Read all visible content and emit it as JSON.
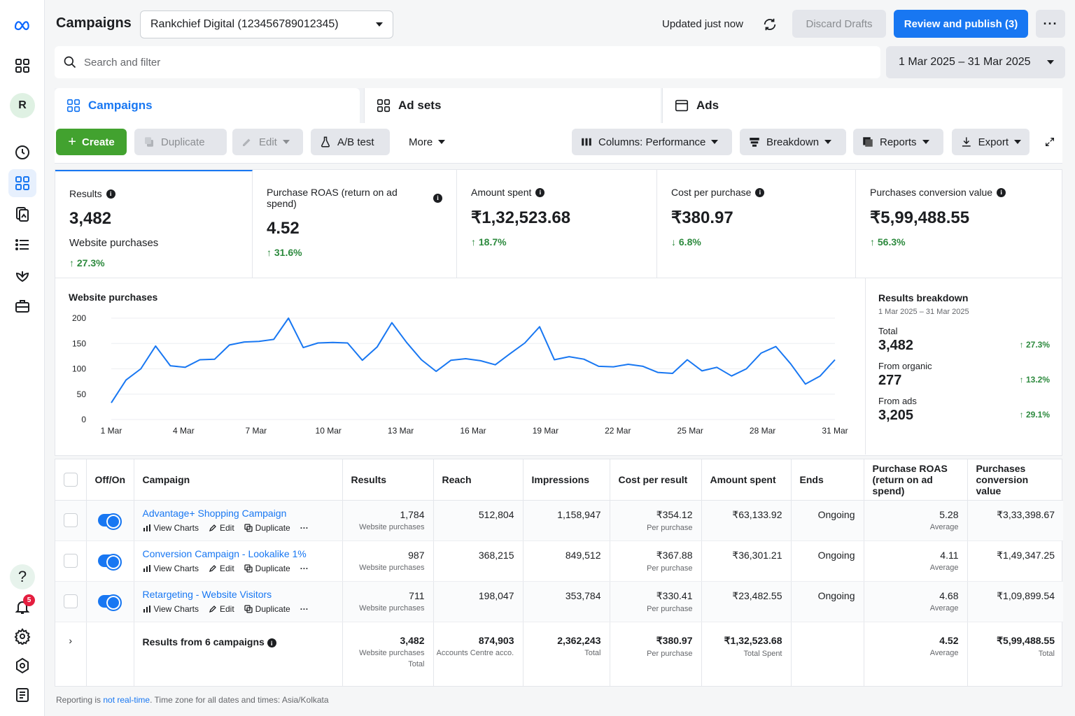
{
  "header": {
    "title": "Campaigns",
    "account": "Rankchief Digital (123456789012345)",
    "updated": "Updated just now",
    "discard": "Discard Drafts",
    "publish": "Review and publish (3)",
    "more": "···"
  },
  "search": {
    "placeholder": "Search and filter"
  },
  "date_range": "1 Mar 2025 – 31 Mar 2025",
  "tabs": [
    {
      "label": "Campaigns",
      "icon": "grid-icon"
    },
    {
      "label": "Ad sets",
      "icon": "grid-icon"
    },
    {
      "label": "Ads",
      "icon": "window-icon"
    }
  ],
  "toolbar": {
    "create": "Create",
    "duplicate": "Duplicate",
    "edit": "Edit",
    "ab_test": "A/B test",
    "more": "More",
    "columns": "Columns: Performance",
    "breakdown": "Breakdown",
    "reports": "Reports",
    "export": "Export"
  },
  "metrics": [
    {
      "label": "Results",
      "value": "3,482",
      "sub": "Website purchases",
      "delta": "↑ 27.3%"
    },
    {
      "label": "Purchase ROAS (return on ad spend)",
      "value": "4.52",
      "delta": "↑ 31.6%"
    },
    {
      "label": "Amount spent",
      "value": "₹1,32,523.68",
      "delta": "↑ 18.7%"
    },
    {
      "label": "Cost per purchase",
      "value": "₹380.97",
      "delta": "↓ 6.8%"
    },
    {
      "label": "Purchases conversion value",
      "value": "₹5,99,488.55",
      "delta": "↑ 56.3%"
    }
  ],
  "chart_data": {
    "type": "line",
    "title": "Website purchases",
    "x": [
      "1 Mar",
      "2 Mar",
      "3 Mar",
      "4 Mar",
      "5 Mar",
      "6 Mar",
      "7 Mar",
      "8 Mar",
      "9 Mar",
      "10 Mar",
      "11 Mar",
      "12 Mar",
      "13 Mar",
      "14 Mar",
      "15 Mar",
      "16 Mar",
      "17 Mar",
      "18 Mar",
      "19 Mar",
      "20 Mar",
      "21 Mar",
      "22 Mar",
      "23 Mar",
      "24 Mar",
      "25 Mar",
      "26 Mar",
      "27 Mar",
      "28 Mar",
      "29 Mar",
      "30 Mar",
      "31 Mar"
    ],
    "xticks": [
      "1 Mar",
      "4 Mar",
      "7 Mar",
      "10 Mar",
      "13 Mar",
      "16 Mar",
      "19 Mar",
      "22 Mar",
      "25 Mar",
      "28 Mar",
      "31 Mar"
    ],
    "series": [
      {
        "values": [
          33,
          78,
          100,
          145,
          106,
          103,
          118,
          119,
          147,
          153,
          154,
          158,
          200,
          142,
          151,
          152,
          151,
          117,
          143,
          191,
          152,
          118,
          95,
          117,
          120,
          116,
          108,
          130,
          151,
          183,
          118,
          124,
          119,
          105,
          104,
          109,
          105,
          93,
          91,
          118,
          96,
          103,
          86,
          100,
          131,
          144,
          110,
          70,
          86,
          118
        ]
      }
    ],
    "yticks": [
      0,
      50,
      100,
      150,
      200
    ],
    "ylim": [
      0,
      200
    ],
    "color": "#1877f2",
    "grid": true
  },
  "breakdown": {
    "title": "Results breakdown",
    "range": "1 Mar 2025 – 31 Mar 2025",
    "rows": [
      {
        "label": "Total",
        "value": "3,482",
        "delta": "↑ 27.3%"
      },
      {
        "label": "From organic",
        "value": "277",
        "delta": "↑ 13.2%"
      },
      {
        "label": "From ads",
        "value": "3,205",
        "delta": "↑ 29.1%"
      }
    ]
  },
  "table": {
    "headers": [
      "Off/On",
      "Campaign",
      "Results",
      "Reach",
      "Impressions",
      "Cost per result",
      "Amount spent",
      "Ends",
      "Purchase ROAS (return on ad spend)",
      "Purchases conversion value"
    ],
    "actions": [
      "View Charts",
      "Edit",
      "Duplicate"
    ],
    "rows": [
      {
        "name": "Advantage+ Shopping Campaign",
        "results": "1,784",
        "results_sub": "Website purchases",
        "reach": "512,804",
        "impressions": "1,158,947",
        "cpr": "₹354.12",
        "cpr_sub": "Per purchase",
        "spent": "₹63,133.92",
        "ends": "Ongoing",
        "roas": "5.28",
        "roas_sub": "Average",
        "value": "₹3,33,398.67"
      },
      {
        "name": "Conversion Campaign - Lookalike 1%",
        "results": "987",
        "results_sub": "Website purchases",
        "reach": "368,215",
        "impressions": "849,512",
        "cpr": "₹367.88",
        "cpr_sub": "Per purchase",
        "spent": "₹36,301.21",
        "ends": "Ongoing",
        "roas": "4.11",
        "roas_sub": "Average",
        "value": "₹1,49,347.25"
      },
      {
        "name": "Retargeting - Website Visitors",
        "results": "711",
        "results_sub": "Website purchases",
        "reach": "198,047",
        "impressions": "353,784",
        "cpr": "₹330.41",
        "cpr_sub": "Per purchase",
        "spent": "₹23,482.55",
        "ends": "Ongoing",
        "roas": "4.68",
        "roas_sub": "Average",
        "value": "₹1,09,899.54"
      }
    ],
    "total": {
      "label": "Results from 6 campaigns",
      "results": "3,482",
      "results_sub": "Website purchases",
      "results_sub2": "Total",
      "reach": "874,903",
      "reach_sub": "Accounts Centre acco...",
      "impressions": "2,362,243",
      "impressions_sub": "Total",
      "cpr": "₹380.97",
      "cpr_sub": "Per purchase",
      "spent": "₹1,32,523.68",
      "spent_sub": "Total Spent",
      "roas": "4.52",
      "roas_sub": "Average",
      "value": "₹5,99,488.55",
      "value_sub": "Total"
    }
  },
  "rail": {
    "avatar": "R",
    "notifications": "5"
  },
  "footer": {
    "part1": "Reporting is ",
    "link": "not real-time",
    "part2": ". Time zone for all dates and times: Asia/Kolkata"
  }
}
